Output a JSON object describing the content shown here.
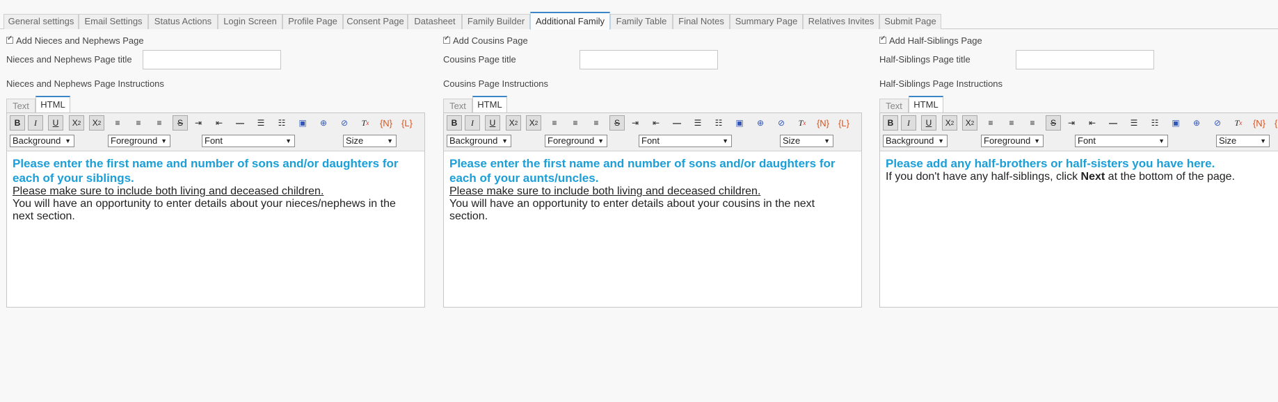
{
  "tabs": [
    {
      "label": "General settings",
      "active": false
    },
    {
      "label": "Email Settings",
      "active": false
    },
    {
      "label": "Status Actions",
      "active": false
    },
    {
      "label": "Login Screen",
      "active": false
    },
    {
      "label": "Profile Page",
      "active": false
    },
    {
      "label": "Consent Page",
      "active": false
    },
    {
      "label": "Datasheet",
      "active": false
    },
    {
      "label": "Family Builder",
      "active": false
    },
    {
      "label": "Additional Family",
      "active": true
    },
    {
      "label": "Family Table",
      "active": false
    },
    {
      "label": "Final Notes",
      "active": false
    },
    {
      "label": "Summary Page",
      "active": false
    },
    {
      "label": "Relatives Invites",
      "active": false
    },
    {
      "label": "Submit Page",
      "active": false
    }
  ],
  "editor": {
    "tab_text": "Text",
    "tab_html": "HTML",
    "selects": {
      "background": "Background",
      "foreground": "Foreground",
      "font": "Font",
      "size": "Size"
    },
    "buttons": {
      "bold": "B",
      "italic": "I",
      "underline": "U",
      "token_n": "{N}",
      "token_l": "{L}"
    }
  },
  "columns": [
    {
      "checkbox_label": "Add Nieces and Nephews Page",
      "title_label": "Nieces and Nephews Page title",
      "instructions_label": "Nieces and Nephews Page Instructions",
      "content": {
        "heading": "Please enter the first name and number of sons and/or daughters for each of your siblings.",
        "underline": "Please make sure to include both living and deceased children.",
        "body": "You will have an opportunity to enter details about your nieces/nephews in the next section."
      }
    },
    {
      "checkbox_label": "Add Cousins Page",
      "title_label": "Cousins Page title",
      "instructions_label": "Cousins Page Instructions",
      "content": {
        "heading": "Please enter the first name and number of sons and/or daughters for each of your aunts/uncles.",
        "underline": "Please make sure to include both living and deceased children.",
        "body": "You will have an opportunity to enter details about your cousins in the next section."
      }
    },
    {
      "checkbox_label": "Add Half-Siblings Page",
      "title_label": "Half-Siblings Page title",
      "instructions_label": "Half-Siblings Page Instructions",
      "content": {
        "heading": "Please add any half-brothers or half-sisters you have here.",
        "body_prefix": "If you don't have any half-siblings, click ",
        "body_bold": "Next",
        "body_suffix": " at the bottom of the page."
      }
    }
  ]
}
